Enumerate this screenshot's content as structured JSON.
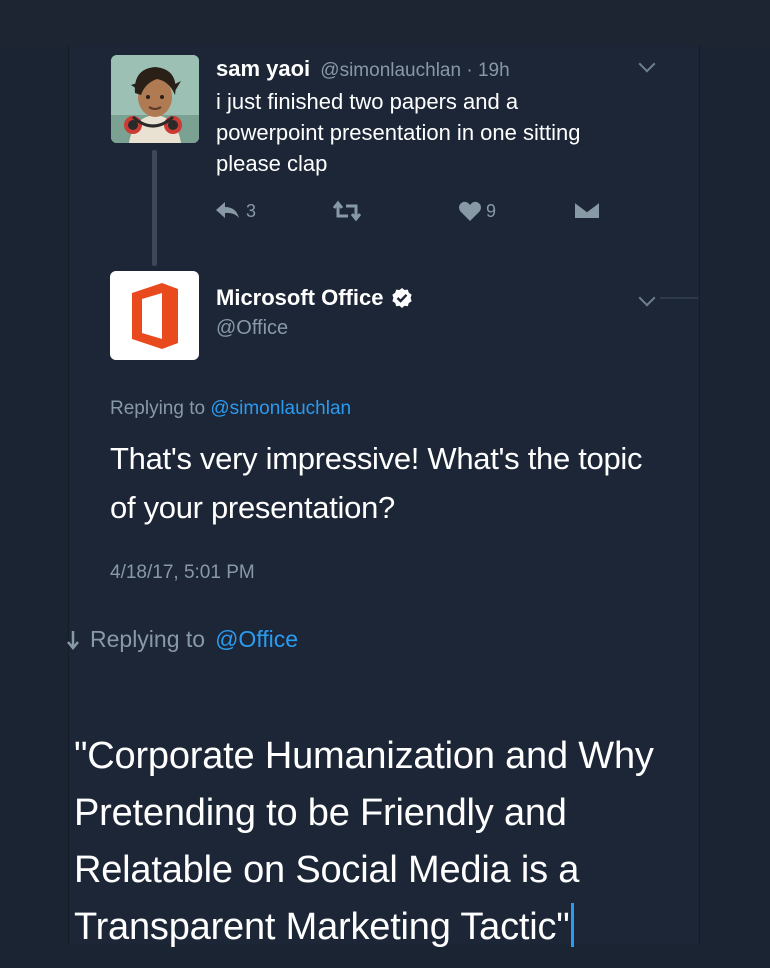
{
  "tweet": {
    "author_name": "sam yaoi",
    "author_handle": "@simonlauchlan",
    "separator": "·",
    "time": "19h",
    "text": "i just finished two papers and a powerpoint presentation in one sitting please clap",
    "reply_count": "3",
    "like_count": "9"
  },
  "reply_tweet": {
    "author_name": "Microsoft Office",
    "author_handle": "@Office",
    "replying_to_label": "Replying to",
    "replying_to_handle": "@simonlauchlan",
    "text": "That's very impressive! What's the topic of your presentation?",
    "timestamp": "4/18/17, 5:01 PM"
  },
  "composer": {
    "replying_to_label": "Replying to",
    "replying_to_handle": "@Office",
    "text": "\"Corporate Humanization and Why Pretending to be Friendly and Relatable on Social Media is a Transparent Marketing Tactic\""
  },
  "colors": {
    "background": "#1c2636",
    "link": "#2b9bf0",
    "muted": "#8899a6",
    "office_logo": "#e8491d"
  }
}
